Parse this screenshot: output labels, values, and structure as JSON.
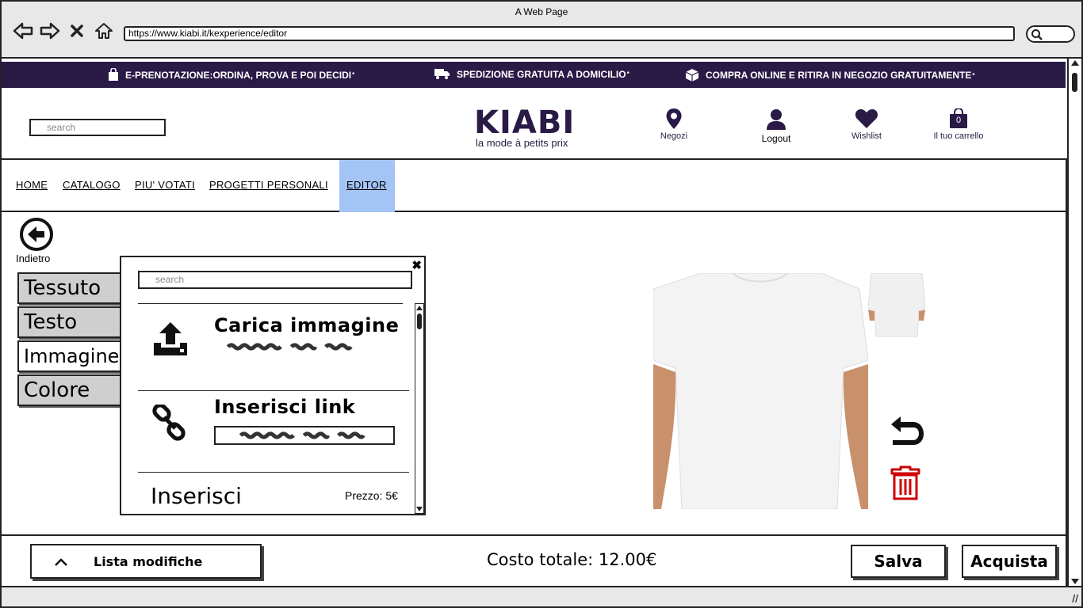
{
  "window": {
    "title": "A Web Page",
    "url": "https://www.kiabi.it/kexperience/editor"
  },
  "promo": {
    "items": [
      {
        "label": "E-PRENOTAZIONE:ORDINA, PROVA E POI DECIDI",
        "sup": "*",
        "icon": "shopping-bag-icon"
      },
      {
        "label": "SPEDIZIONE GRATUITA A DOMICILIO",
        "sup": "*",
        "icon": "truck-icon"
      },
      {
        "label": "COMPRA ONLINE E RITIRA IN NEGOZIO GRATUITAMENTE",
        "sup": "*",
        "icon": "package-icon"
      }
    ],
    "bg_color": "#2a1a46"
  },
  "header": {
    "search_placeholder": "search",
    "logo": {
      "brand": "KIABI",
      "tagline": "la mode à petits prix"
    },
    "links": {
      "stores": "Negozi",
      "logout": "Logout",
      "wishlist": "Wishlist",
      "cart": "Il tuo carrello"
    },
    "cart_count": "0"
  },
  "nav": {
    "items": [
      "HOME",
      "CATALOGO",
      "PIU' VOTATI",
      "PROGETTI PERSONALI",
      "EDITOR"
    ],
    "active": "EDITOR",
    "active_color": "#a3c4f4"
  },
  "editor": {
    "back_label": "Indietro",
    "tabs": [
      "Tessuto",
      "Testo",
      "Immagine",
      "Colore"
    ],
    "active_tab": "Immagine",
    "panel": {
      "search_placeholder": "search",
      "upload_title": "Carica immagine",
      "link_title": "Inserisci link",
      "insert_label": "Inserisci",
      "price_label": "Prezzo: 5€"
    },
    "trash_color": "#cc0000"
  },
  "footer": {
    "changes_label": "Lista modifiche",
    "total_label": "Costo totale: 12.00€",
    "save_label": "Salva",
    "buy_label": "Acquista"
  }
}
